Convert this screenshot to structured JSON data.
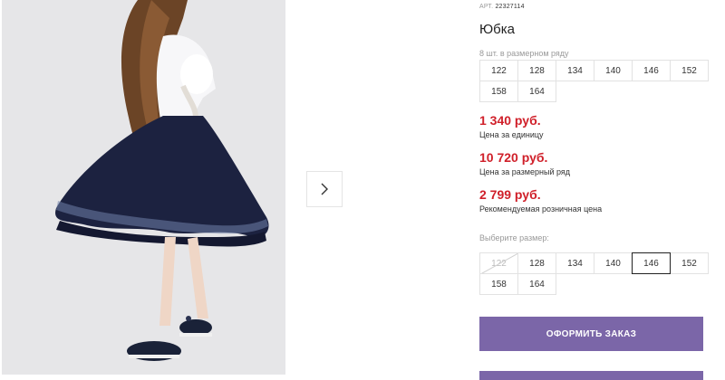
{
  "product": {
    "article_label": "АРТ.",
    "article_number": "22327114",
    "title": "Юбка",
    "pack_caption": "8 шт. в размерном ряду",
    "pack_sizes": [
      "122",
      "128",
      "134",
      "140",
      "146",
      "152",
      "158",
      "164"
    ]
  },
  "gallery": {
    "next_icon": "chevron-right-icon"
  },
  "prices": {
    "unit_price": "1 340 руб.",
    "unit_caption": "Цена за единицу",
    "series_price": "10 720 руб.",
    "series_caption": "Цена за размерный ряд",
    "retail_price": "2 799 руб.",
    "retail_caption": "Рекомендуемая розничная цена"
  },
  "size_selector": {
    "label": "Выберите размер:",
    "sizes": [
      "122",
      "128",
      "134",
      "140",
      "146",
      "152",
      "158",
      "164"
    ],
    "disabled": [
      "122"
    ],
    "selected": "146"
  },
  "order_button_label": "ОФОРМИТЬ ЗАКАЗ",
  "colors": {
    "price_red": "#d0202a",
    "button_purple": "#7b66a8",
    "skirt_navy": "#1c2240"
  }
}
